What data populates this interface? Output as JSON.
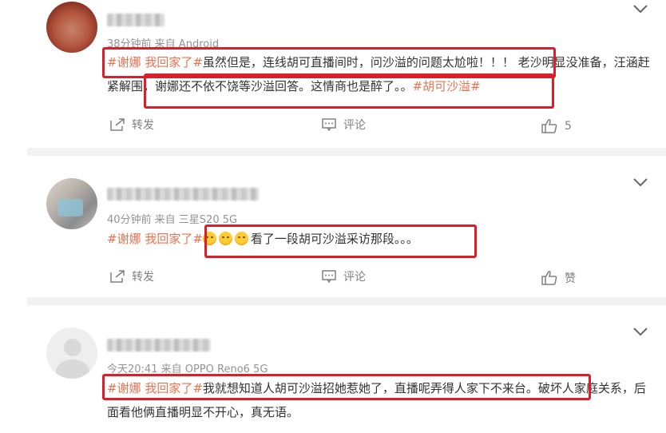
{
  "colors": {
    "topic": "#eb7350",
    "highlight": "#d9202a",
    "meta": "#939393",
    "text": "#333333"
  },
  "comments": [
    {
      "meta": "38分钟前  来自 Android",
      "topic1": "#谢娜 我回家了#",
      "text1": "虽然但是，连线胡可直播间时，问沙溢的问题太尬啦！！！ 老沙明显没准备，汪涵赶紧解围，谢娜还不依不饶等沙溢回答。这情商也是醉了。。",
      "topic2": "#胡可沙溢#",
      "repost": "转发",
      "comment": "评论",
      "like": "5"
    },
    {
      "meta": "40分钟前  来自 三星S20 5G",
      "topic1": "#谢娜 我回家了#",
      "text1": "看了一段胡可沙溢采访那段。。。",
      "repost": "转发",
      "comment": "评论",
      "like": "赞"
    },
    {
      "meta": "今天20:41  来自 OPPO Reno6 5G",
      "topic1": "#谢娜 我回家了#",
      "text1": "我就想知道人胡可沙溢招她惹她了，直播呢弄得人家下不来台。破坏人家庭关系，后面看他俩直播明显不开心，真无语。"
    }
  ]
}
